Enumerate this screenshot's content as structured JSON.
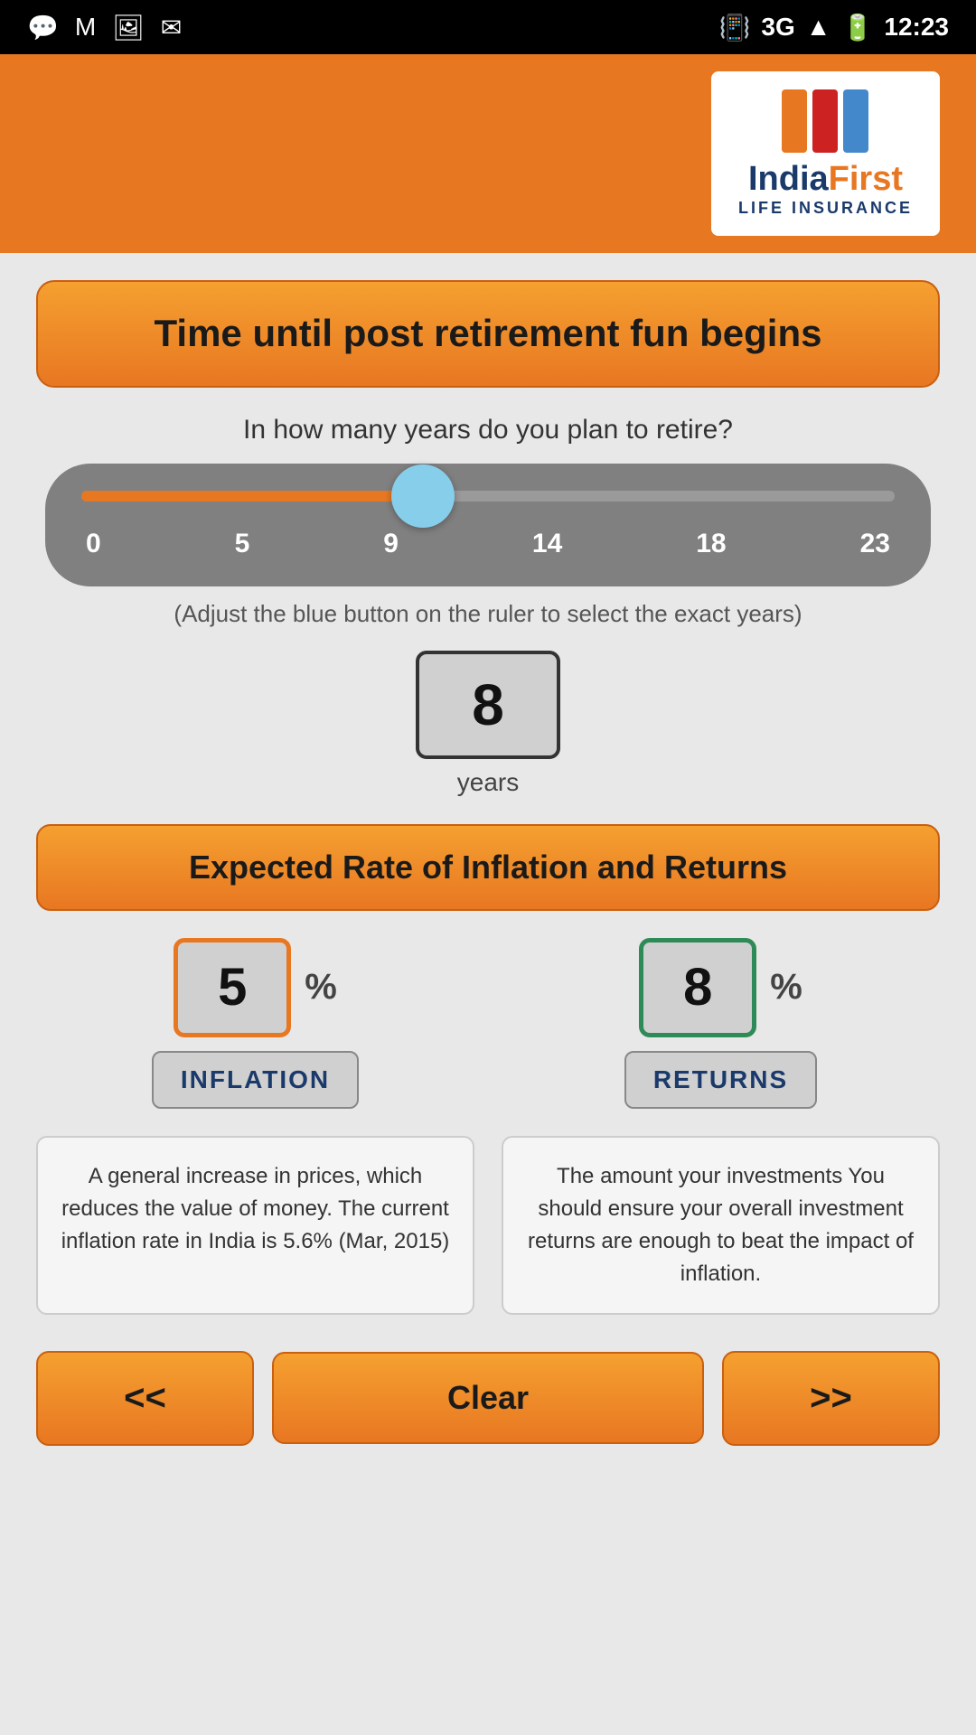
{
  "status_bar": {
    "time": "12:23",
    "network": "3G"
  },
  "header": {
    "logo_india": "India",
    "logo_first": "First",
    "logo_sub": "LIFE INSURANCE"
  },
  "title_section": {
    "title": "Time until post retirement fun begins",
    "subtitle": "In how many years do you plan to retire?"
  },
  "slider": {
    "labels": [
      "0",
      "5",
      "9",
      "14",
      "18",
      "23"
    ],
    "hint": "(Adjust the blue button on the ruler to select the exact years)",
    "value": "8",
    "unit": "years"
  },
  "inflation_section": {
    "header": "Expected Rate of Inflation and Returns",
    "inflation": {
      "value": "5",
      "percent": "%",
      "label": "INFLATION",
      "description": "A general increase in prices, which reduces the value of money. The current inflation rate in India is 5.6% (Mar, 2015)"
    },
    "returns": {
      "value": "8",
      "percent": "%",
      "label": "RETURNS",
      "description": "The amount your investments You should ensure your overall investment returns are enough to beat the impact of inflation."
    }
  },
  "buttons": {
    "prev": "<<",
    "clear": "Clear",
    "next": ">>"
  }
}
